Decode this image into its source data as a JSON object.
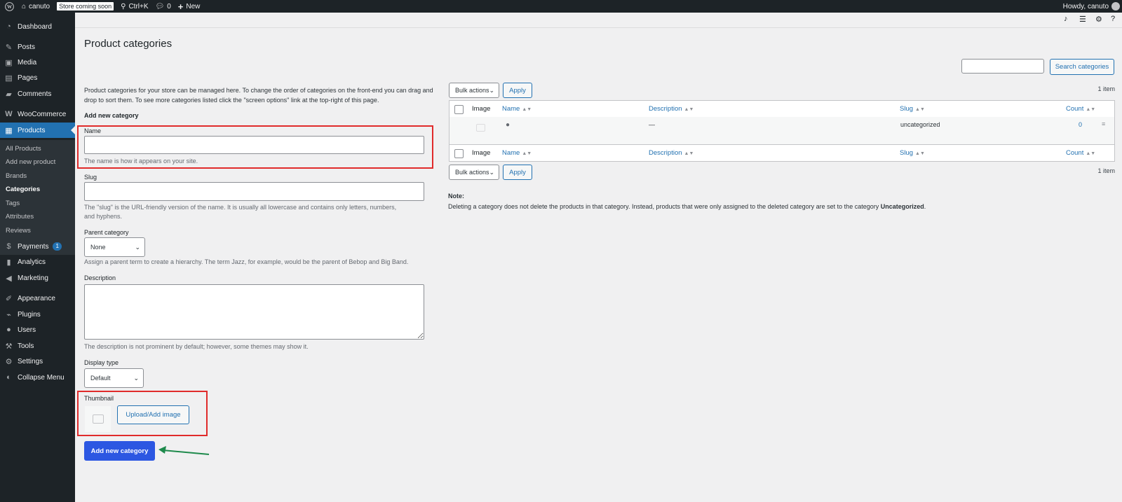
{
  "admin_bar": {
    "site_name": "canuto",
    "store_badge": "Store coming soon",
    "shortcut": "Ctrl+K",
    "comments_count": "0",
    "new_label": "New",
    "howdy": "Howdy, canuto"
  },
  "sidebar": {
    "items": [
      {
        "label": "Dashboard",
        "icon": "dashboard-icon"
      },
      {
        "label": "Posts",
        "icon": "pin-icon"
      },
      {
        "label": "Media",
        "icon": "media-icon"
      },
      {
        "label": "Pages",
        "icon": "pages-icon"
      },
      {
        "label": "Comments",
        "icon": "comment-icon"
      },
      {
        "label": "WooCommerce",
        "icon": "woo-icon"
      },
      {
        "label": "Products",
        "icon": "products-icon"
      },
      {
        "label": "Payments",
        "icon": "dollar-icon",
        "badge": "1"
      },
      {
        "label": "Analytics",
        "icon": "bar-chart-icon"
      },
      {
        "label": "Marketing",
        "icon": "megaphone-icon"
      },
      {
        "label": "Appearance",
        "icon": "brush-icon"
      },
      {
        "label": "Plugins",
        "icon": "plug-icon"
      },
      {
        "label": "Users",
        "icon": "user-icon"
      },
      {
        "label": "Tools",
        "icon": "wrench-icon"
      },
      {
        "label": "Settings",
        "icon": "settings-icon"
      },
      {
        "label": "Collapse Menu",
        "icon": "collapse-icon"
      }
    ],
    "submenu": [
      "All Products",
      "Add new product",
      "Brands",
      "Categories",
      "Tags",
      "Attributes",
      "Reviews"
    ]
  },
  "page": {
    "title": "Product categories",
    "intro": "Product categories for your store can be managed here. To change the order of categories on the front-end you can drag and drop to sort them. To see more categories listed click the \"screen options\" link at the top-right of this page."
  },
  "form": {
    "heading": "Add new category",
    "name_label": "Name",
    "name_value": "",
    "name_help": "The name is how it appears on your site.",
    "slug_label": "Slug",
    "slug_value": "",
    "slug_help": "The \"slug\" is the URL-friendly version of the name. It is usually all lowercase and contains only letters, numbers, and hyphens.",
    "parent_label": "Parent category",
    "parent_value": "None",
    "parent_help": "Assign a parent term to create a hierarchy. The term Jazz, for example, would be the parent of Bebop and Big Band.",
    "description_label": "Description",
    "description_value": "",
    "description_help": "The description is not prominent by default; however, some themes may show it.",
    "display_label": "Display type",
    "display_value": "Default",
    "thumbnail_label": "Thumbnail",
    "upload_button": "Upload/Add image",
    "submit_button": "Add new category"
  },
  "list": {
    "search_button": "Search categories",
    "search_value": "",
    "bulk_actions": "Bulk actions",
    "apply": "Apply",
    "items_count": "1 item",
    "columns": {
      "image": "Image",
      "name": "Name",
      "description": "Description",
      "slug": "Slug",
      "count": "Count"
    },
    "rows": [
      {
        "name": "",
        "description": "—",
        "slug": "uncategorized",
        "count": "0"
      }
    ]
  },
  "note": {
    "heading": "Note:",
    "text_before": "Deleting a category does not delete the products in that category. Instead, products that were only assigned to the deleted category are set to the category ",
    "text_bold": "Uncategorized",
    "text_after": "."
  },
  "annotations": {
    "highlight_color": "#e02b2b",
    "arrow_color": "#1e8a4c"
  }
}
